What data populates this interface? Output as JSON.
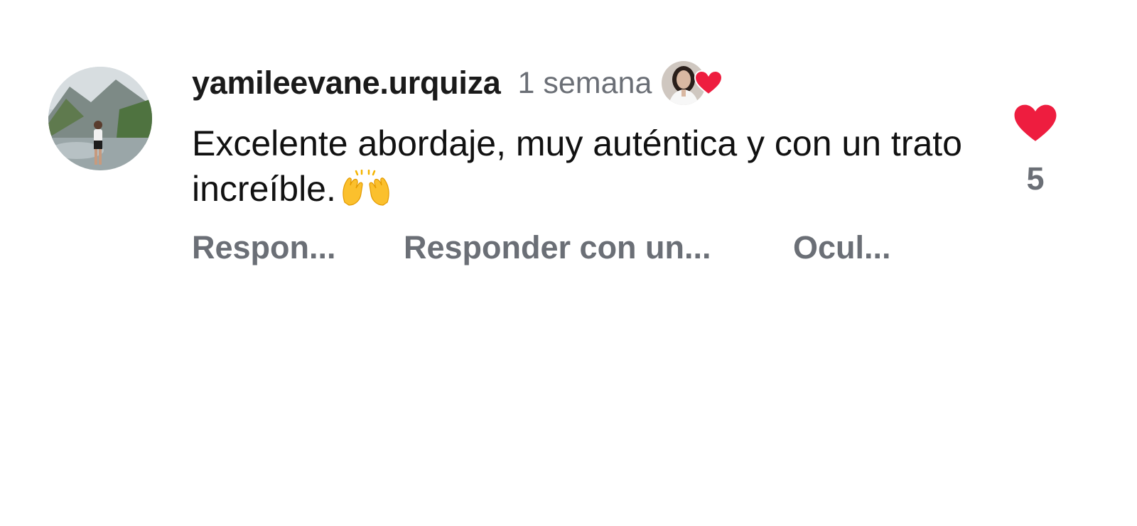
{
  "comment": {
    "username": "yamileevane.urquiza",
    "timestamp": "1 semana",
    "text": "Excelente abordaje, muy auténtica y con un trato increíble.",
    "emoji_icon": "raising-hands-icon",
    "creator_liked": true,
    "like_count": "5"
  },
  "actions": {
    "reply_label": "Respon...",
    "reply_with_label": "Responder con un...",
    "hide_label": "Ocul..."
  },
  "colors": {
    "like_red": "#ee1d3f",
    "secondary_text": "#6b6f76",
    "primary_text": "#111111"
  },
  "icons": {
    "like": "heart-icon",
    "creator_like": "creator-heart-icon"
  }
}
